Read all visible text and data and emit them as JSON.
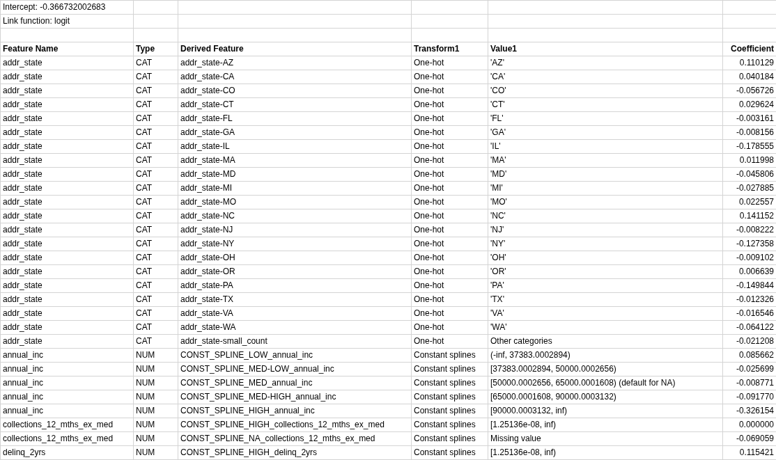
{
  "notes": [
    "Intercept: -0.366732002683",
    "Link function: logit"
  ],
  "table": {
    "columns": [
      "Feature Name",
      "Type",
      "Derived Feature",
      "Transform1",
      "Value1",
      "Coefficient"
    ],
    "rows": [
      [
        "addr_state",
        "CAT",
        "addr_state-AZ",
        "One-hot",
        "'AZ'",
        "0.110129"
      ],
      [
        "addr_state",
        "CAT",
        "addr_state-CA",
        "One-hot",
        "'CA'",
        "0.040184"
      ],
      [
        "addr_state",
        "CAT",
        "addr_state-CO",
        "One-hot",
        "'CO'",
        "-0.056726"
      ],
      [
        "addr_state",
        "CAT",
        "addr_state-CT",
        "One-hot",
        "'CT'",
        "0.029624"
      ],
      [
        "addr_state",
        "CAT",
        "addr_state-FL",
        "One-hot",
        "'FL'",
        "-0.003161"
      ],
      [
        "addr_state",
        "CAT",
        "addr_state-GA",
        "One-hot",
        "'GA'",
        "-0.008156"
      ],
      [
        "addr_state",
        "CAT",
        "addr_state-IL",
        "One-hot",
        "'IL'",
        "-0.178555"
      ],
      [
        "addr_state",
        "CAT",
        "addr_state-MA",
        "One-hot",
        "'MA'",
        "0.011998"
      ],
      [
        "addr_state",
        "CAT",
        "addr_state-MD",
        "One-hot",
        "'MD'",
        "-0.045806"
      ],
      [
        "addr_state",
        "CAT",
        "addr_state-MI",
        "One-hot",
        "'MI'",
        "-0.027885"
      ],
      [
        "addr_state",
        "CAT",
        "addr_state-MO",
        "One-hot",
        "'MO'",
        "0.022557"
      ],
      [
        "addr_state",
        "CAT",
        "addr_state-NC",
        "One-hot",
        "'NC'",
        "0.141152"
      ],
      [
        "addr_state",
        "CAT",
        "addr_state-NJ",
        "One-hot",
        "'NJ'",
        "-0.008222"
      ],
      [
        "addr_state",
        "CAT",
        "addr_state-NY",
        "One-hot",
        "'NY'",
        "-0.127358"
      ],
      [
        "addr_state",
        "CAT",
        "addr_state-OH",
        "One-hot",
        "'OH'",
        "-0.009102"
      ],
      [
        "addr_state",
        "CAT",
        "addr_state-OR",
        "One-hot",
        "'OR'",
        "0.006639"
      ],
      [
        "addr_state",
        "CAT",
        "addr_state-PA",
        "One-hot",
        "'PA'",
        "-0.149844"
      ],
      [
        "addr_state",
        "CAT",
        "addr_state-TX",
        "One-hot",
        "'TX'",
        "-0.012326"
      ],
      [
        "addr_state",
        "CAT",
        "addr_state-VA",
        "One-hot",
        "'VA'",
        "-0.016546"
      ],
      [
        "addr_state",
        "CAT",
        "addr_state-WA",
        "One-hot",
        "'WA'",
        "-0.064122"
      ],
      [
        "addr_state",
        "CAT",
        "addr_state-small_count",
        "One-hot",
        "Other categories",
        "-0.021208"
      ],
      [
        "annual_inc",
        "NUM",
        "CONST_SPLINE_LOW_annual_inc",
        "Constant splines",
        "(-inf, 37383.0002894)",
        "0.085662"
      ],
      [
        "annual_inc",
        "NUM",
        "CONST_SPLINE_MED-LOW_annual_inc",
        "Constant splines",
        "[37383.0002894, 50000.0002656)",
        "-0.025699"
      ],
      [
        "annual_inc",
        "NUM",
        "CONST_SPLINE_MED_annual_inc",
        "Constant splines",
        "[50000.0002656, 65000.0001608) (default for NA)",
        "-0.008771"
      ],
      [
        "annual_inc",
        "NUM",
        "CONST_SPLINE_MED-HIGH_annual_inc",
        "Constant splines",
        "[65000.0001608, 90000.0003132)",
        "-0.091770"
      ],
      [
        "annual_inc",
        "NUM",
        "CONST_SPLINE_HIGH_annual_inc",
        "Constant splines",
        "[90000.0003132, inf)",
        "-0.326154"
      ],
      [
        "collections_12_mths_ex_med",
        "NUM",
        "CONST_SPLINE_HIGH_collections_12_mths_ex_med",
        "Constant splines",
        "[1.25136e-08, inf)",
        "0.000000"
      ],
      [
        "collections_12_mths_ex_med",
        "NUM",
        "CONST_SPLINE_NA_collections_12_mths_ex_med",
        "Constant splines",
        "Missing value",
        "-0.069059"
      ],
      [
        "delinq_2yrs",
        "NUM",
        "CONST_SPLINE_HIGH_delinq_2yrs",
        "Constant splines",
        "[1.25136e-08, inf)",
        "0.115421"
      ]
    ]
  }
}
